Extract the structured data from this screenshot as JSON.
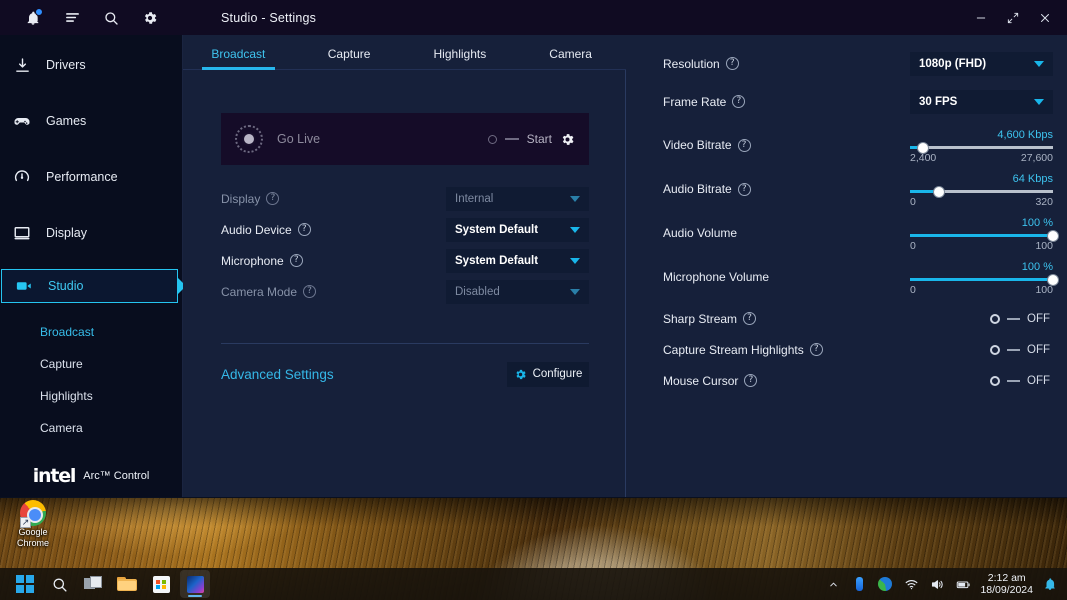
{
  "window": {
    "title": "Studio - Settings",
    "controls": {
      "minimize": "minimize-icon",
      "expand": "expand-icon",
      "close": "close-icon"
    },
    "topbar_icons": [
      "notifications-bell-icon",
      "menu-icon",
      "search-icon",
      "gear-icon"
    ]
  },
  "sidebar": {
    "items": [
      {
        "label": "Drivers",
        "icon": "download-icon",
        "active": false
      },
      {
        "label": "Games",
        "icon": "gamepad-icon",
        "active": false
      },
      {
        "label": "Performance",
        "icon": "speedometer-icon",
        "active": false
      },
      {
        "label": "Display",
        "icon": "monitor-icon",
        "active": false
      },
      {
        "label": "Studio",
        "icon": "video-camera-icon",
        "active": true
      }
    ],
    "sub_items": [
      {
        "label": "Broadcast",
        "active": true
      },
      {
        "label": "Capture",
        "active": false
      },
      {
        "label": "Highlights",
        "active": false
      },
      {
        "label": "Camera",
        "active": false
      }
    ],
    "brand": {
      "name": "intel",
      "product": "Arc™ Control"
    }
  },
  "tabs": [
    {
      "label": "Broadcast",
      "active": true
    },
    {
      "label": "Capture",
      "active": false
    },
    {
      "label": "Highlights",
      "active": false
    },
    {
      "label": "Camera",
      "active": false
    }
  ],
  "golive": {
    "label": "Go Live",
    "start_label": "Start",
    "gear": "gear-icon",
    "record": "record-dot-icon"
  },
  "left_settings": [
    {
      "label": "Display",
      "help": "?",
      "value": "Internal",
      "disabled": true
    },
    {
      "label": "Audio Device",
      "help": "?",
      "value": "System Default",
      "disabled": false
    },
    {
      "label": "Microphone",
      "help": "?",
      "value": "System Default",
      "disabled": false
    },
    {
      "label": "Camera Mode",
      "help": "?",
      "value": "Disabled",
      "disabled": true
    }
  ],
  "advanced": {
    "link_label": "Advanced Settings",
    "configure_label": "Configure",
    "configure_icon": "gear-icon"
  },
  "right_settings": {
    "dropdowns": [
      {
        "label": "Resolution",
        "help": "?",
        "value": "1080p (FHD)"
      },
      {
        "label": "Frame Rate",
        "help": "?",
        "value": "30 FPS"
      }
    ],
    "sliders": [
      {
        "label": "Video Bitrate",
        "help": "?",
        "value_text": "4,600 Kbps",
        "min_text": "2,400",
        "max_text": "27,600",
        "percent": 9
      },
      {
        "label": "Audio Bitrate",
        "help": "?",
        "value_text": "64 Kbps",
        "min_text": "0",
        "max_text": "320",
        "percent": 20
      },
      {
        "label": "Audio Volume",
        "help": "",
        "value_text": "100 %",
        "min_text": "0",
        "max_text": "100",
        "percent": 100
      },
      {
        "label": "Microphone Volume",
        "help": "",
        "value_text": "100 %",
        "min_text": "0",
        "max_text": "100",
        "percent": 100
      }
    ],
    "toggles": [
      {
        "label": "Sharp Stream",
        "help": "?",
        "state": "OFF"
      },
      {
        "label": "Capture Stream Highlights",
        "help": "?",
        "state": "OFF"
      },
      {
        "label": "Mouse Cursor",
        "help": "?",
        "state": "OFF"
      }
    ]
  },
  "desktop": {
    "icon": {
      "label_line1": "Google",
      "label_line2": "Chrome",
      "icon": "chrome-icon"
    }
  },
  "taskbar": {
    "buttons": [
      {
        "name": "start-button",
        "icon": "windows-logo-icon",
        "active": false
      },
      {
        "name": "search-button",
        "icon": "search-icon",
        "active": false
      },
      {
        "name": "task-view-button",
        "icon": "task-view-icon",
        "active": false
      },
      {
        "name": "file-explorer-button",
        "icon": "folder-icon",
        "active": false
      },
      {
        "name": "microsoft-store-button",
        "icon": "store-icon",
        "active": false
      },
      {
        "name": "arc-control-button",
        "icon": "arc-control-icon",
        "active": true
      }
    ],
    "tray": [
      "chevron-up-icon",
      "intel-tray-icon",
      "app-tray-icon",
      "wifi-icon",
      "volume-icon",
      "battery-icon"
    ],
    "clock": {
      "time": "2:12 am",
      "date": "18/09/2024"
    },
    "notification_icon": "bell-icon"
  },
  "colors": {
    "accent_cyan": "#19b6ea",
    "link_cyan": "#35b8e8",
    "panel_bg": "#16203a",
    "sidebar_bg": "#080d1e",
    "titlebar_bg": "#100b22"
  }
}
